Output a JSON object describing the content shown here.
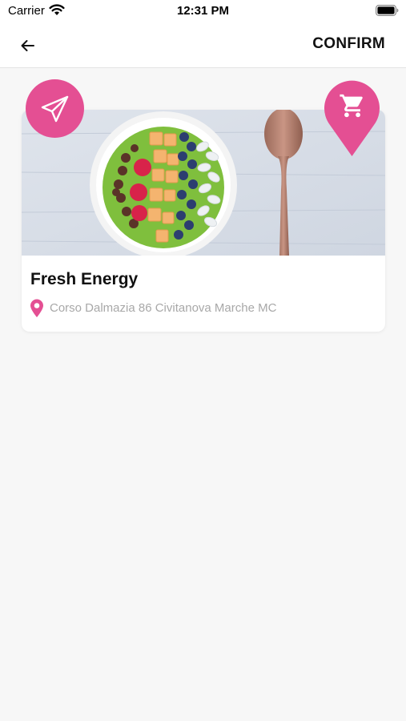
{
  "status_bar": {
    "carrier": "Carrier",
    "time": "12:31 PM"
  },
  "nav": {
    "back_icon": "arrow-left-icon",
    "confirm_label": "CONFIRM"
  },
  "store": {
    "name": "Fresh Energy",
    "address": "Corso Dalmazia 86 Civitanova Marche MC",
    "image": "smoothie-bowl-photo"
  },
  "actions": {
    "send_icon": "paper-plane-icon",
    "cart_icon": "shopping-cart-icon"
  },
  "colors": {
    "accent": "#e44f93",
    "background": "#f7f7f7",
    "muted_text": "#a8a8a8"
  }
}
